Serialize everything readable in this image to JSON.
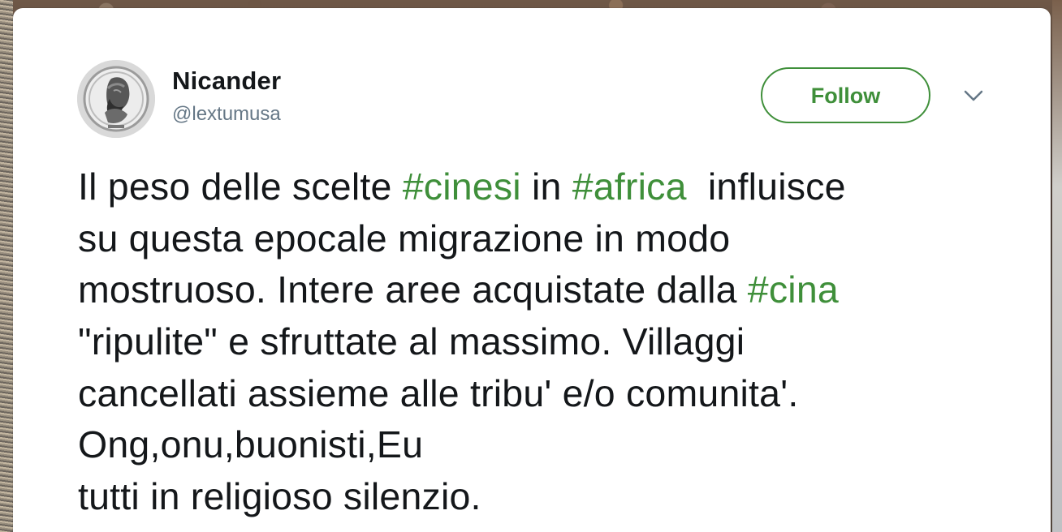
{
  "tweet": {
    "author_name": "Nicander",
    "author_handle": "@lextumusa",
    "follow_label": "Follow",
    "icons": {
      "avatar": "portrait-medallion-avatar",
      "more": "chevron-down-icon"
    },
    "colors": {
      "accent": "#3f8f3a",
      "text": "#14171a",
      "secondary": "#657786"
    },
    "text_lines": [
      {
        "segments": [
          {
            "text": "Il peso delle scelte ",
            "type": "text"
          },
          {
            "text": "#cinesi",
            "type": "hashtag"
          },
          {
            "text": " in ",
            "type": "text"
          },
          {
            "text": "#africa",
            "type": "hashtag"
          },
          {
            "text": "  influisce",
            "type": "text"
          }
        ]
      },
      {
        "segments": [
          {
            "text": "su questa epocale migrazione in modo",
            "type": "text"
          }
        ]
      },
      {
        "segments": [
          {
            "text": "mostruoso. Intere aree acquistate dalla ",
            "type": "text"
          },
          {
            "text": "#cina",
            "type": "hashtag"
          }
        ]
      },
      {
        "segments": [
          {
            "text": "\"ripulite\" e sfruttate al massimo. Villaggi",
            "type": "text"
          }
        ]
      },
      {
        "segments": [
          {
            "text": "cancellati assieme alle tribu' e/o comunita'.",
            "type": "text"
          }
        ]
      },
      {
        "segments": [
          {
            "text": "Ong,onu,buonisti,Eu",
            "type": "text"
          }
        ]
      },
      {
        "segments": [
          {
            "text": "tutti in religioso silenzio.",
            "type": "text"
          }
        ]
      }
    ]
  }
}
